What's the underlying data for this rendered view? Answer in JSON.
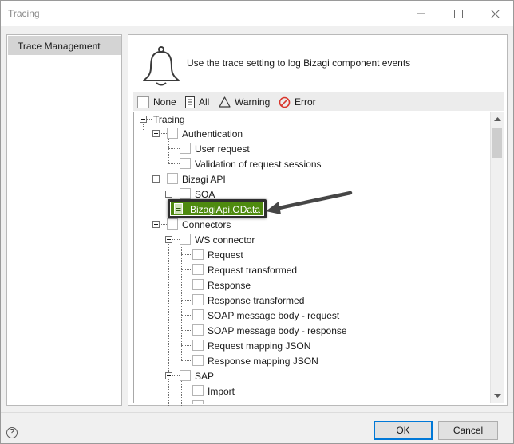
{
  "window": {
    "title": "Tracing"
  },
  "sidebar": {
    "items": [
      {
        "label": "Trace Management"
      }
    ]
  },
  "header": {
    "icon": "bell-icon",
    "description": "Use the trace setting to log Bizagi component events"
  },
  "filters": [
    {
      "label": "None",
      "icon": "checkbox-empty-icon"
    },
    {
      "label": "All",
      "icon": "document-lines-icon"
    },
    {
      "label": "Warning",
      "icon": "warning-triangle-icon"
    },
    {
      "label": "Error",
      "icon": "no-entry-icon",
      "color": "#d9352b"
    }
  ],
  "tree": {
    "root": "Tracing",
    "authentication": "Authentication",
    "user_request": "User request",
    "validation": "Validation of request sessions",
    "bizagi_api": "Bizagi API",
    "soa": "SOA",
    "odata": "BizagiApi.OData",
    "connectors": "Connectors",
    "ws_connector": "WS connector",
    "request": "Request",
    "request_transformed": "Request transformed",
    "response": "Response",
    "response_transformed": "Response transformed",
    "soap_request": "SOAP message body - request",
    "soap_response": "SOAP message body - response",
    "request_mapping": "Request mapping JSON",
    "response_mapping": "Response mapping JSON",
    "sap": "SAP",
    "import": "Import"
  },
  "selection": {
    "color": "#4e8a0f"
  },
  "footer": {
    "help": "?",
    "ok_label": "OK",
    "cancel_label": "Cancel"
  }
}
